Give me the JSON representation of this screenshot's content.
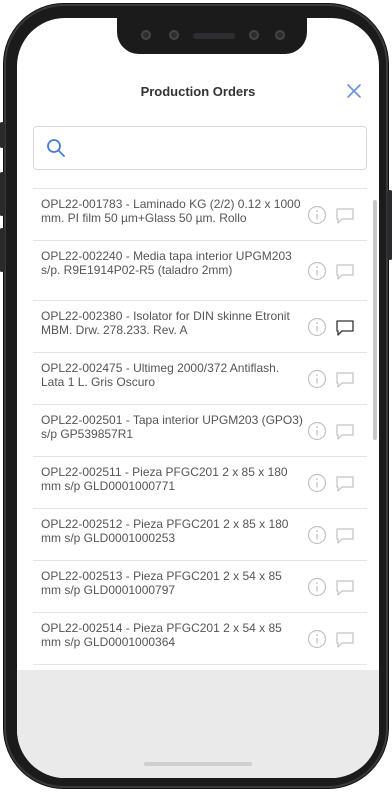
{
  "header": {
    "title": "Production Orders"
  },
  "search": {
    "value": "",
    "placeholder": ""
  },
  "orders": [
    {
      "label": "OPL22-001783 - Laminado KG (2/2) 0.12 x 1000 mm. PI film 50 µm+Glass 50 µm. Rollo",
      "comment_active": false
    },
    {
      "label": "OPL22-002240 - Media tapa interior UPGM203 s/p. R9E1914P02-R5 (taladro 2mm)",
      "comment_active": false
    },
    {
      "label": "OPL22-002380 - Isolator for DIN skinne Etronit MBM. Drw. 278.233. Rev. A",
      "comment_active": true
    },
    {
      "label": "OPL22-002475 - Ultimeg 2000/372 Antiflash. Lata 1 L. Gris Oscuro",
      "comment_active": false
    },
    {
      "label": "OPL22-002501 - Tapa interior UPGM203 (GPO3) s/p GP539857R1",
      "comment_active": false
    },
    {
      "label": "OPL22-002511 - Pieza PFGC201 2 x 85 x 180 mm s/p GLD0001000771",
      "comment_active": false
    },
    {
      "label": "OPL22-002512 - Pieza PFGC201 2 x 85 x 180 mm s/p GLD0001000253",
      "comment_active": false
    },
    {
      "label": "OPL22-002513 - Pieza PFGC201 2 x 54 x 85 mm s/p GLD0001000797",
      "comment_active": false
    },
    {
      "label": "OPL22-002514 - Pieza PFGC201 2 x 54 x 85 mm s/p GLD0001000364",
      "comment_active": false
    }
  ],
  "icons": {
    "close": "close-icon",
    "search": "search-icon",
    "info": "info-icon",
    "comment": "comment-icon"
  },
  "colors": {
    "accent": "#4a7bd6",
    "icon_inactive": "#c2c2c2",
    "icon_active": "#333333",
    "text": "#555555"
  }
}
